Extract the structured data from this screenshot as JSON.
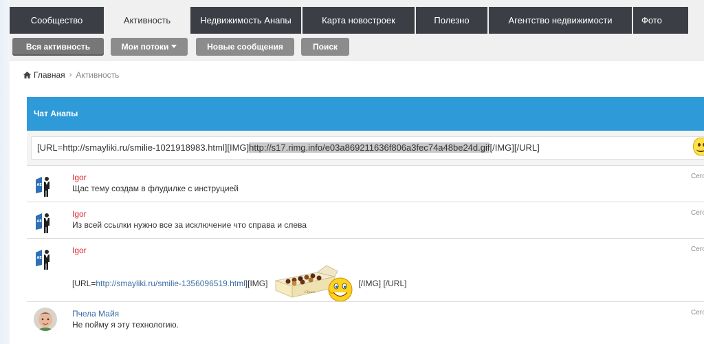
{
  "nav": {
    "tabs": [
      {
        "label": "Сообщество",
        "active": false
      },
      {
        "label": "Активность",
        "active": true
      },
      {
        "label": "Недвижимость Анапы",
        "active": false
      },
      {
        "label": "Карта новостроек",
        "active": false
      },
      {
        "label": "Полезно",
        "active": false
      },
      {
        "label": "Агентство недвижимости",
        "active": false
      },
      {
        "label": "Фото",
        "active": false
      }
    ],
    "subnav": {
      "all_activity": "Вся активность",
      "my_streams": "Мои потоки",
      "new_messages": "Новые сообщения",
      "search": "Поиск"
    }
  },
  "breadcrumb": {
    "home": "Главная",
    "current": "Активность"
  },
  "chat": {
    "title": "Чат Анапы",
    "input": {
      "prefix": "[URL=http://smayliki.ru/smilie-1021918983.html][IMG]",
      "selected": "http://s17.rimg.info/e03a869211636f806a3fec74a48be24d.gif",
      "suffix": "[/IMG][/URL]"
    },
    "messages": [
      {
        "author": "Igor",
        "text": "Щас тему создам в флудилке с инструцией",
        "time": "Сего"
      },
      {
        "author": "Igor",
        "text": "Из всей ссылки нужно все за исключение что справа и слева",
        "time": "Сего"
      },
      {
        "author": "Igor",
        "time": "Сего",
        "prefix": "[URL=",
        "link": "http://smayliki.ru/smilie-1356096519.html",
        "mid": "][IMG]",
        "suffix": "[/IMG] [/URL]"
      },
      {
        "author": "Пчела Майя",
        "text": "Не пойму я эту технологию.",
        "time": "Сего"
      }
    ]
  },
  "colors": {
    "nav_dark": "#3b3f45",
    "chat_header": "#2e9ad8",
    "author_red": "#e0262e",
    "author_blue": "#3b6ea5",
    "link": "#3b6ea5"
  }
}
